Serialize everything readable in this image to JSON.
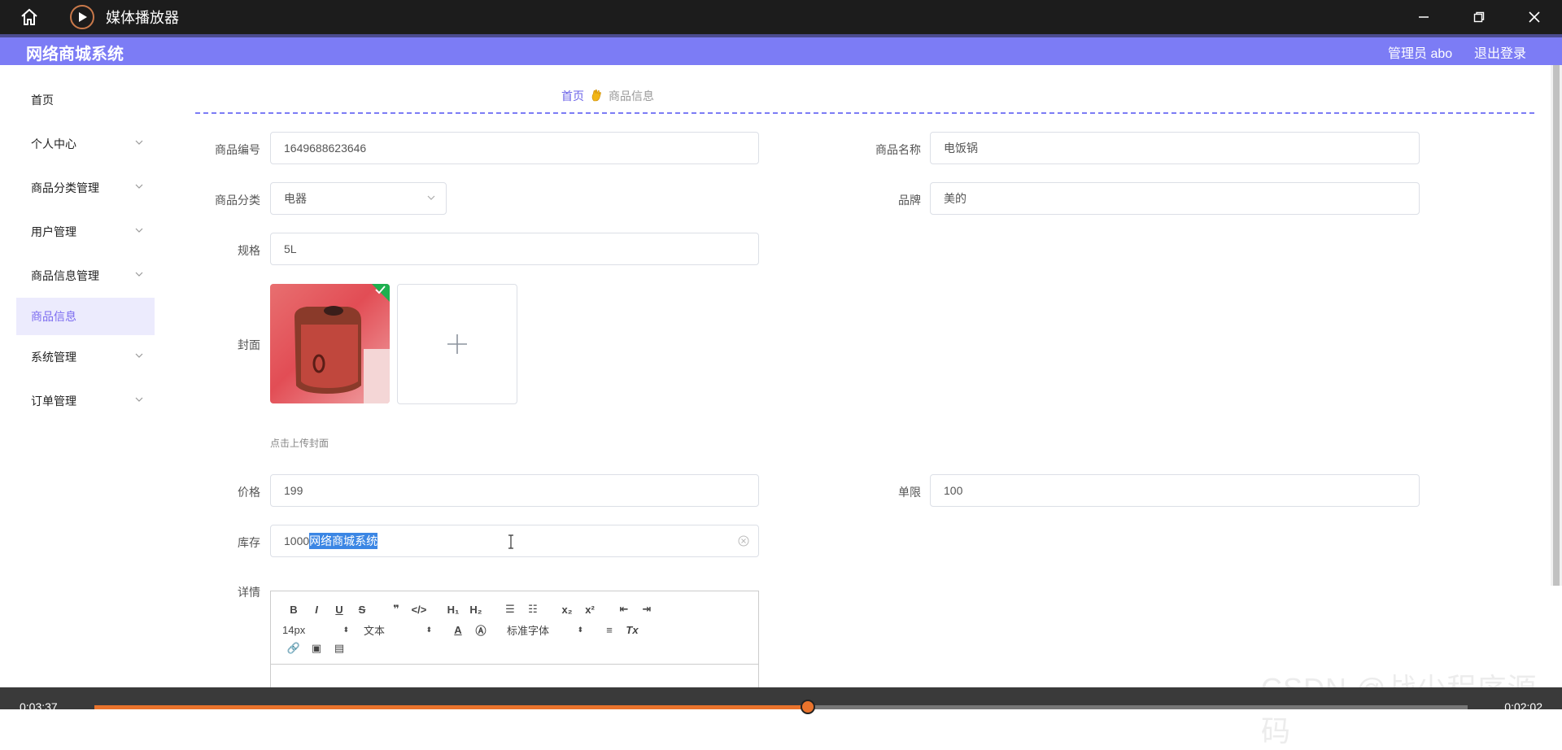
{
  "window": {
    "title": "媒体播放器"
  },
  "header": {
    "brand": "网络商城系统",
    "user": "管理员 abo",
    "logout": "退出登录"
  },
  "sidebar": {
    "items": [
      {
        "label": "首页",
        "expandable": false
      },
      {
        "label": "个人中心",
        "expandable": true
      },
      {
        "label": "商品分类管理",
        "expandable": true
      },
      {
        "label": "用户管理",
        "expandable": true
      },
      {
        "label": "商品信息管理",
        "expandable": true
      },
      {
        "label": "商品信息",
        "expandable": false,
        "active": true
      },
      {
        "label": "系统管理",
        "expandable": true
      },
      {
        "label": "订单管理",
        "expandable": true
      }
    ]
  },
  "breadcrumb": {
    "home": "首页",
    "current": "商品信息"
  },
  "form": {
    "product_no": {
      "label": "商品编号",
      "value": "1649688623646"
    },
    "product_name": {
      "label": "商品名称",
      "value": "电饭锅"
    },
    "category": {
      "label": "商品分类",
      "value": "电器"
    },
    "brand": {
      "label": "品牌",
      "value": "美的"
    },
    "spec": {
      "label": "规格",
      "value": "5L"
    },
    "cover": {
      "label": "封面",
      "hint": "点击上传封面"
    },
    "price": {
      "label": "价格",
      "value": "199"
    },
    "limit": {
      "label": "单限",
      "value": "100"
    },
    "stock": {
      "label": "库存",
      "value": "1000",
      "selected_text": "网络商城系统"
    },
    "detail": {
      "label": "详情"
    }
  },
  "editor": {
    "font_size": "14px",
    "block_type": "文本",
    "font_family": "标准字体"
  },
  "player": {
    "elapsed": "0:03:37",
    "remaining": "0:02:02",
    "progress": 0.52
  },
  "watermark": "CSDN @战少程序源码",
  "colors": {
    "accent": "#7c7cf5",
    "active_text": "#7c6cf0",
    "progress": "#e9732c"
  }
}
